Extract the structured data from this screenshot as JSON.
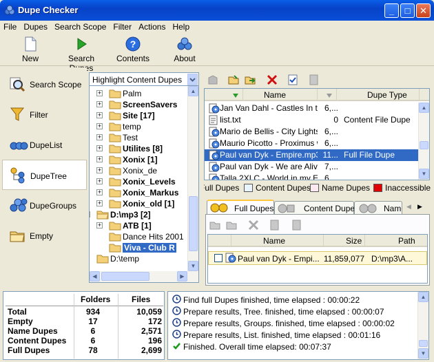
{
  "window": {
    "title": "Dupe Checker"
  },
  "menu": [
    "File",
    "Dupes",
    "Search Scope",
    "Filter",
    "Actions",
    "Help"
  ],
  "toolbar": [
    {
      "label": "New",
      "icon": "new-document-icon"
    },
    {
      "label": "Search Dupes",
      "icon": "play-icon"
    },
    {
      "label": "Contents",
      "icon": "help-icon"
    },
    {
      "label": "About",
      "icon": "about-icon"
    }
  ],
  "nav": [
    {
      "label": "Search Scope",
      "icon": "search-scope-icon"
    },
    {
      "label": "Filter",
      "icon": "filter-icon"
    },
    {
      "label": "DupeList",
      "icon": "dupelist-icon"
    },
    {
      "label": "DupeTree",
      "icon": "dupetree-icon",
      "selected": true
    },
    {
      "label": "DupeGroups",
      "icon": "dupegroups-icon"
    },
    {
      "label": "Empty",
      "icon": "empty-icon"
    }
  ],
  "highlight_combo": {
    "value": "Highlight Content Dupes"
  },
  "tree": [
    {
      "label": "Palm",
      "bold": false
    },
    {
      "label": "ScreenSavers",
      "bold": true
    },
    {
      "label": "Site [17]",
      "bold": true
    },
    {
      "label": "temp",
      "bold": false
    },
    {
      "label": "Test",
      "bold": false
    },
    {
      "label": "Utilites [8]",
      "bold": true
    },
    {
      "label": "Xonix [1]",
      "bold": true
    },
    {
      "label": "Xonix_de",
      "bold": false
    },
    {
      "label": "Xonix_Levels",
      "bold": true
    },
    {
      "label": "Xonix_Markus",
      "bold": true
    },
    {
      "label": "Xonix_old [1]",
      "bold": true
    },
    {
      "label": "D:\\mp3 [2]",
      "bold": true
    },
    {
      "label": "ATB [1]",
      "bold": true
    },
    {
      "label": "Dance Hits 2001",
      "bold": false
    },
    {
      "label": "Viva - Club R",
      "bold": true,
      "selected": true
    },
    {
      "label": "D:\\temp",
      "bold": false
    }
  ],
  "top_list": {
    "columns": [
      "Name",
      "Dupe Type"
    ],
    "rows": [
      {
        "name": "Jan Van Dahl - Castles In t...",
        "size": "6,...",
        "type": ""
      },
      {
        "name": "list.txt",
        "size": "0",
        "type": "Content File Dupe"
      },
      {
        "name": "Mario de Bellis - City Lights....",
        "size": "6,...",
        "type": ""
      },
      {
        "name": "Maurio Picotto - Proximus w...",
        "size": "6,...",
        "type": ""
      },
      {
        "name": "Paul van Dyk - Empire.mp3",
        "size": "11...",
        "type": "Full File Dupe",
        "selected": true
      },
      {
        "name": "Paul van Dyk - We are Aliv...",
        "size": "7,...",
        "type": ""
      },
      {
        "name": "Talla 2XLC - World in my E...",
        "size": "6,...",
        "type": ""
      }
    ]
  },
  "legend": [
    {
      "label": "Full Dupes",
      "color": "#d8eaff"
    },
    {
      "label": "Content Dupes",
      "color": "#e8f4ff"
    },
    {
      "label": "Name Dupes",
      "color": "#ffe8f0"
    },
    {
      "label": "Inaccessible",
      "color": "#e00000"
    }
  ],
  "tabs": [
    "Full Dupes",
    "Content Dupes",
    "Name"
  ],
  "bottom_list": {
    "columns": [
      "Name",
      "Size",
      "Path"
    ],
    "rows": [
      {
        "name": "Paul van Dyk - Empi...",
        "size": "11,859,077",
        "path": "D:\\mp3\\A..."
      }
    ]
  },
  "stats": {
    "headers": [
      "Folders",
      "Files"
    ],
    "rows": [
      {
        "label": "Total",
        "folders": "934",
        "files": "10,059"
      },
      {
        "label": "Empty",
        "folders": "17",
        "files": "172"
      },
      {
        "label": "Name Dupes",
        "folders": "6",
        "files": "2,571"
      },
      {
        "label": "Content Dupes",
        "folders": "6",
        "files": "196"
      },
      {
        "label": "Full Dupes",
        "folders": "78",
        "files": "2,699"
      }
    ]
  },
  "log": [
    {
      "text": "Find full Dupes finished, time elapsed : 00:00:22",
      "icon": "info-icon"
    },
    {
      "text": "Prepare results, Tree. finished, time elapsed : 00:00:07",
      "icon": "info-icon"
    },
    {
      "text": "Prepare results, Groups. finished, time elapsed : 00:00:02",
      "icon": "info-icon"
    },
    {
      "text": "Prepare results, List. finished, time elapsed : 00:01:16",
      "icon": "info-icon"
    },
    {
      "text": "Finished. Overall time elapsed: 00:07:37",
      "icon": "check-icon"
    }
  ]
}
